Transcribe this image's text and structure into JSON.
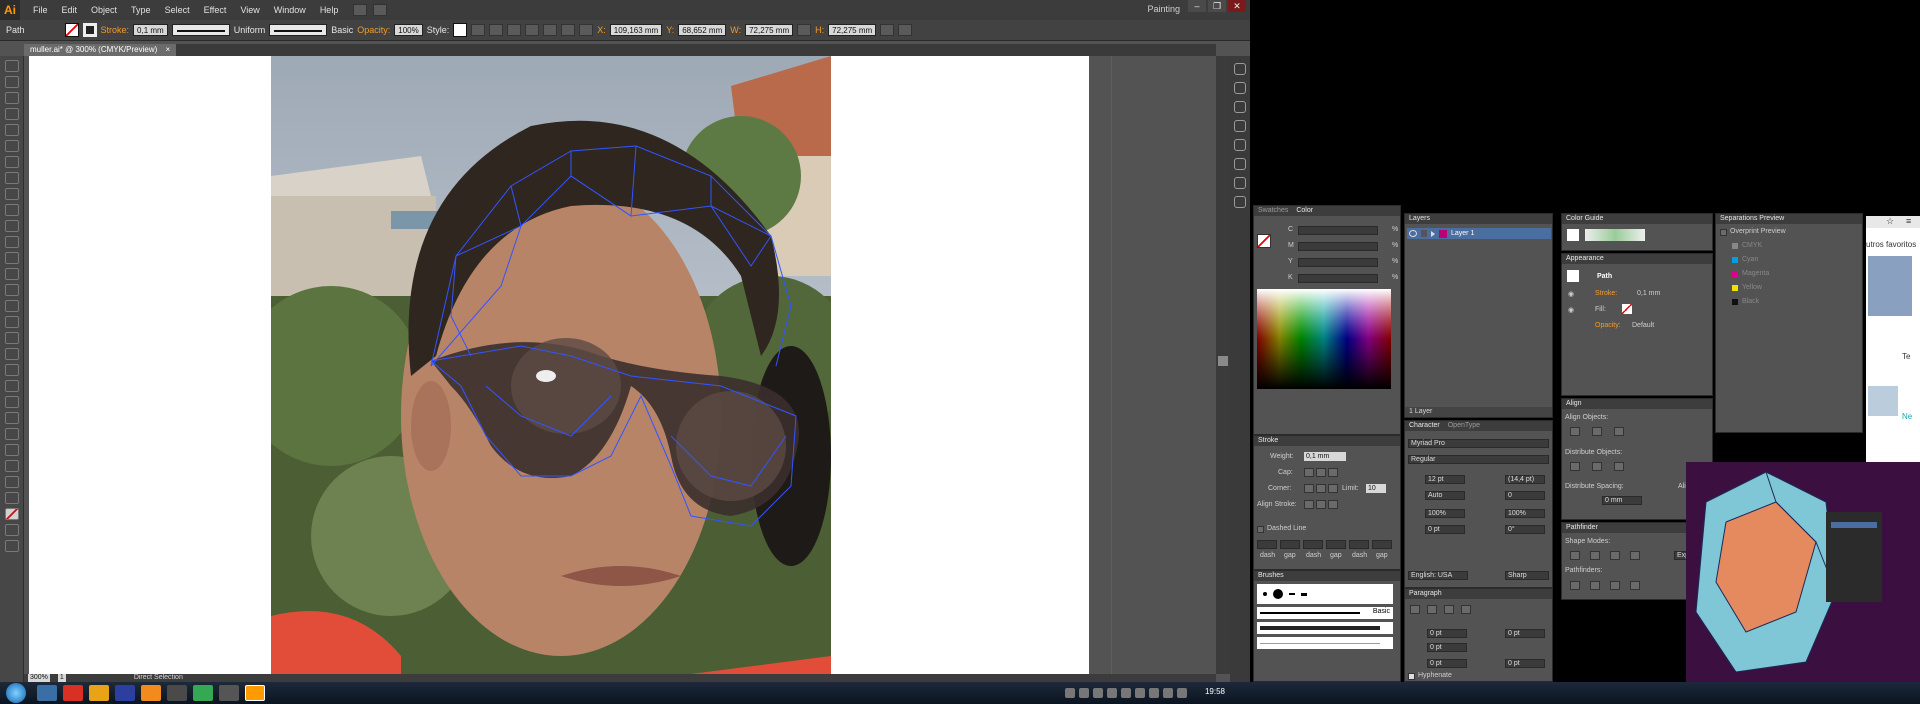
{
  "menu": {
    "items": [
      "File",
      "Edit",
      "Object",
      "Type",
      "Select",
      "Effect",
      "View",
      "Window",
      "Help"
    ],
    "workspace": "Painting"
  },
  "control": {
    "selection_type": "Path",
    "stroke_label": "Stroke:",
    "stroke_weight": "0,1 mm",
    "profile": "Uniform",
    "brush": "Basic",
    "opacity_label": "Opacity:",
    "opacity": "100%",
    "style_label": "Style:",
    "x_label": "X:",
    "x": "109,163 mm",
    "y_label": "Y:",
    "y": "68,652 mm",
    "w_label": "W:",
    "w": "72,275 mm",
    "h_label": "H:",
    "h": "72,275 mm"
  },
  "document": {
    "tab": "muller.ai* @ 300% (CMYK/Preview)",
    "tab_close": "×"
  },
  "status": {
    "zoom": "300%",
    "page": "1",
    "tool": "Direct Selection"
  },
  "swatches": {
    "tab": "Swatches",
    "color_tab": "Color",
    "labels": [
      "C",
      "M",
      "Y",
      "K"
    ],
    "units": [
      "%",
      "%",
      "%",
      "%"
    ]
  },
  "stroke": {
    "title": "Stroke",
    "weight_label": "Weight:",
    "weight": "0,1 mm",
    "cap_label": "Cap:",
    "corner_label": "Corner:",
    "limit_label": "Limit:",
    "limit": "10",
    "align_label": "Align Stroke:",
    "dashed_label": "Dashed Line",
    "dash_labels": [
      "dash",
      "gap",
      "dash",
      "gap",
      "dash",
      "gap"
    ]
  },
  "brushes": {
    "title": "Brushes",
    "basic": "Basic"
  },
  "layers": {
    "title": "Layers",
    "layer_name": "Layer 1",
    "footer": "1 Layer"
  },
  "character": {
    "title": "Character",
    "opentype_tab": "OpenType",
    "font": "Myriad Pro",
    "style": "Regular",
    "size": "12 pt",
    "leading": "(14,4 pt)",
    "kerning": "Auto",
    "tracking": "0",
    "vscale": "100%",
    "hscale": "100%",
    "baseline": "0 pt",
    "rotation": "0°",
    "language": "English: USA",
    "aa": "Sharp"
  },
  "paragraph": {
    "title": "Paragraph",
    "indent_left": "0 pt",
    "indent_right": "0 pt",
    "first_line": "0 pt",
    "space_before": "0 pt",
    "space_after": "0 pt",
    "hyphenate": "Hyphenate"
  },
  "color_guide": {
    "title": "Color Guide"
  },
  "appearance": {
    "title": "Appearance",
    "object": "Path",
    "stroke_label": "Stroke:",
    "stroke_value": "0,1 mm",
    "fill_label": "Fill:",
    "opacity_label": "Opacity:",
    "opacity_value": "Default"
  },
  "align": {
    "title": "Align",
    "align_objects": "Align Objects:",
    "distribute_objects": "Distribute Objects:",
    "distribute_spacing": "Distribute Spacing:",
    "align_to": "Align To:",
    "spacing_value": "0 mm"
  },
  "pathfinder": {
    "title": "Pathfinder",
    "shape_modes": "Shape Modes:",
    "expand": "Expand",
    "pathfinders": "Pathfinders:"
  },
  "separations": {
    "title": "Separations Preview",
    "overprint": "Overprint Preview",
    "inks": [
      "CMYK",
      "Cyan",
      "Magenta",
      "Yellow",
      "Black"
    ],
    "ink_colors": [
      "#888888",
      "#00a0e0",
      "#e0008a",
      "#f0e000",
      "#111111"
    ]
  },
  "browser": {
    "text": "utros favoritos",
    "partial1": "Te",
    "partial2": "Ne"
  },
  "taskbar": {
    "time": "19:58"
  },
  "colors": {
    "accent": "#ff9a00",
    "selection": "#3355ff"
  }
}
